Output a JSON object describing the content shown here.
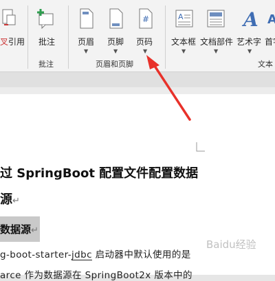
{
  "ribbon": {
    "buttons": {
      "reference": "引用",
      "reference_prefix": "叉",
      "comment": "批注",
      "header": "页眉",
      "footer": "页脚",
      "page_number": "页码",
      "text_box": "文本框",
      "doc_parts": "文档部件",
      "wordart": "艺术字",
      "dropcap": "首字"
    },
    "groups": {
      "comment": "批注",
      "header_footer": "页眉和页脚",
      "text": "文本"
    }
  },
  "document": {
    "heading1": "过 SpringBoot 配置文件配置数据",
    "heading2": "源",
    "heading3": "数据源",
    "body_line1_a": "g-boot-starter-",
    "body_line1_b": "jdbc",
    "body_line1_c": " 启动器中默认使用的是",
    "body_line2": "arce  作为数据源在  SpringBoot2x  版本中的",
    "return_mark": "↵"
  },
  "watermark": "Baidu经验",
  "colors": {
    "arrow": "#e8312a",
    "ribbon_bg": "#f3f3f3",
    "heading3_highlight": "#c9c9c9",
    "spell_check": "#d03030"
  }
}
